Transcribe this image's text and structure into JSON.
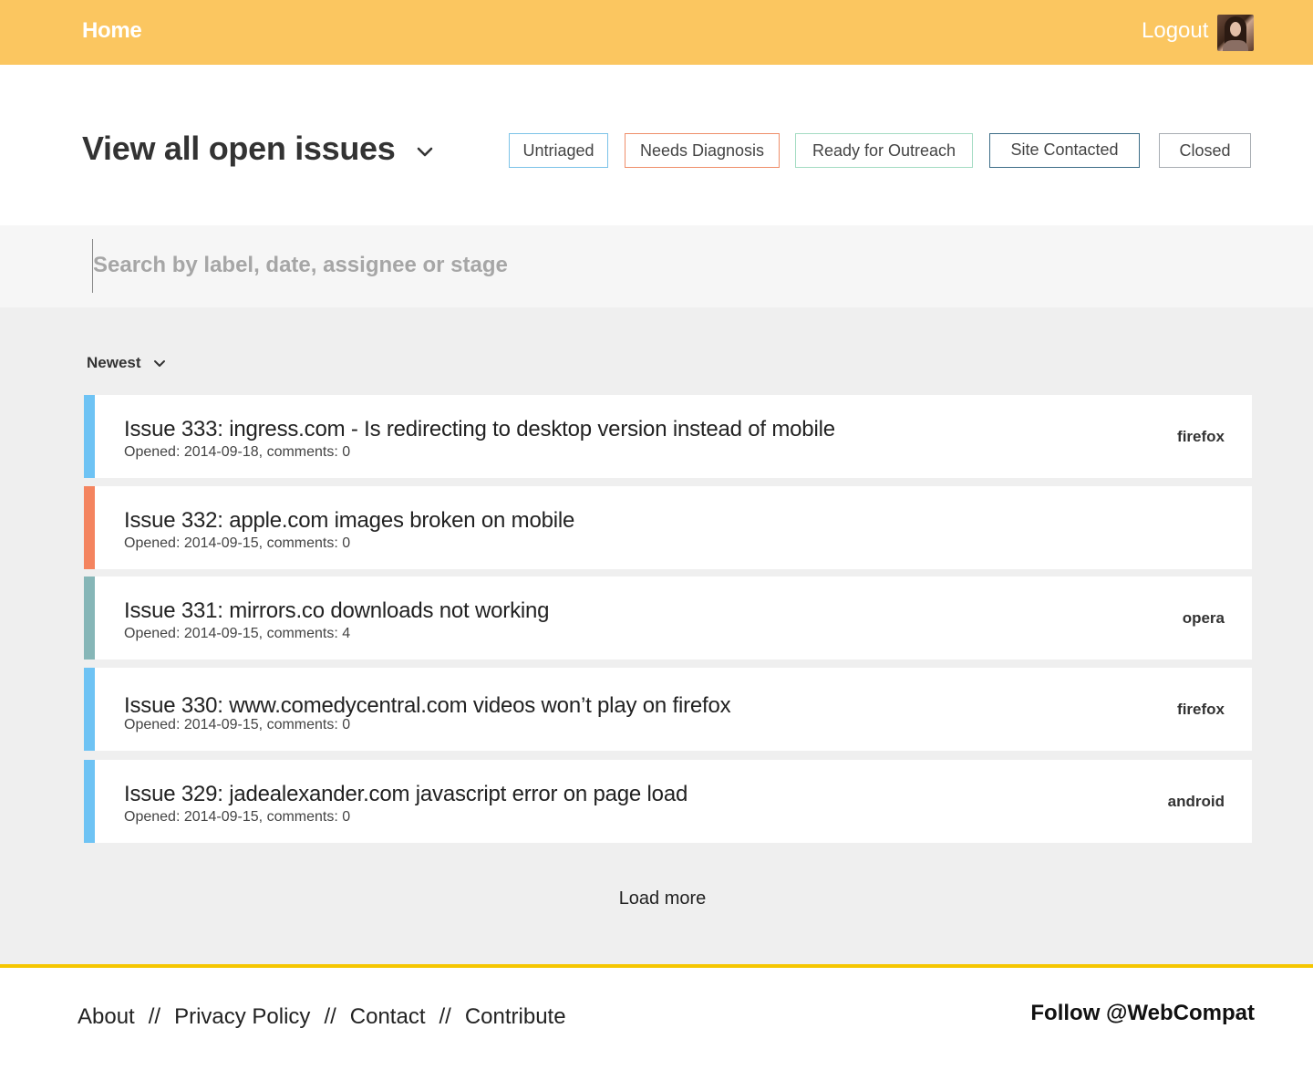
{
  "header": {
    "home_label": "Home",
    "logout_label": "Logout",
    "bar_color": "#fbc660"
  },
  "title_row": {
    "title": "View all open issues",
    "filters": [
      {
        "label": "Untriaged",
        "color": "#7cc3e8"
      },
      {
        "label": "Needs Diagnosis",
        "color": "#ef8e6a"
      },
      {
        "label": "Ready for Outreach",
        "color": "#a4dcc3"
      },
      {
        "label": "Site Contacted",
        "color": "#3d6d87"
      },
      {
        "label": "Closed",
        "color": "#a8adb3"
      }
    ]
  },
  "search": {
    "placeholder": "Search by label, date, assignee or stage",
    "value": ""
  },
  "sort": {
    "label": "Newest"
  },
  "issues": [
    {
      "title": "Issue 333: ingress.com - Is redirecting to desktop version instead of mobile",
      "meta": "Opened: 2014-09-18, comments: 0",
      "label": "firefox",
      "stripe": "#6ec3f4"
    },
    {
      "title": "Issue 332: apple.com images broken on mobile",
      "meta": "Opened: 2014-09-15, comments: 0",
      "label": "",
      "stripe": "#f4845f"
    },
    {
      "title": "Issue 331: mirrors.co downloads not working",
      "meta": "Opened: 2014-09-15, comments: 4",
      "label": "opera",
      "stripe": "#86b6b7"
    },
    {
      "title": "Issue 330: www.comedycentral.com videos won’t play on firefox",
      "meta": "Opened: 2014-09-15, comments: 0",
      "label": "firefox",
      "stripe": "#6ec3f4"
    },
    {
      "title": "Issue 329: jadealexander.com javascript error on page load",
      "meta": "Opened: 2014-09-15, comments: 0",
      "label": "android",
      "stripe": "#6ec3f4"
    }
  ],
  "load_more_label": "Load more",
  "footer": {
    "links": [
      "About",
      "Privacy Policy",
      "Contact",
      "Contribute"
    ],
    "separator": "//",
    "follow_label": "Follow @WebCompat",
    "rule_color": "#f5c600"
  }
}
